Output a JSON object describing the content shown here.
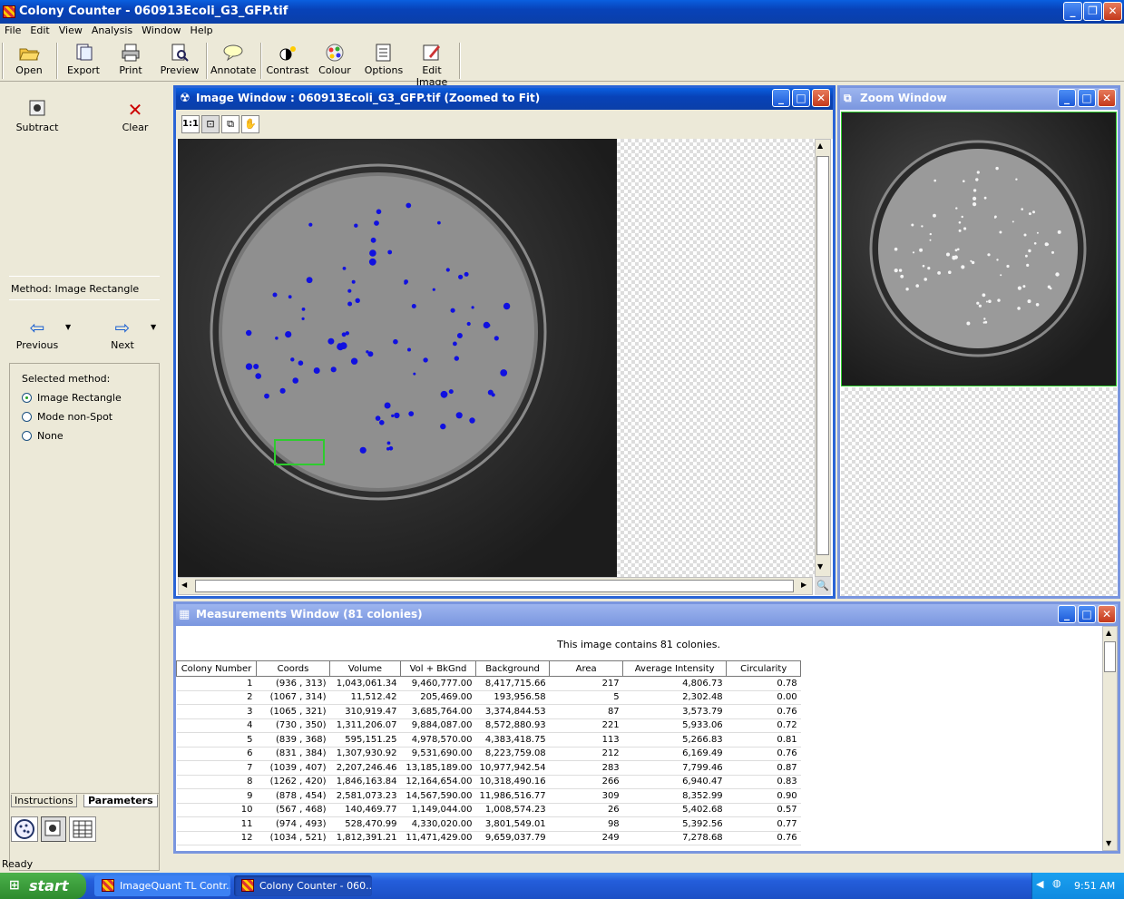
{
  "app": {
    "title": "Colony Counter - 060913Ecoli_G3_GFP.tif"
  },
  "menu": [
    "File",
    "Edit",
    "View",
    "Analysis",
    "Window",
    "Help"
  ],
  "toolbar": [
    {
      "label": "Open",
      "icon": "open-folder-icon"
    },
    {
      "label": "Export",
      "icon": "export-icon"
    },
    {
      "label": "Print",
      "icon": "print-icon"
    },
    {
      "label": "Preview",
      "icon": "preview-icon"
    },
    {
      "label": "Annotate",
      "icon": "annotate-icon"
    },
    {
      "label": "Contrast",
      "icon": "contrast-icon"
    },
    {
      "label": "Colour",
      "icon": "colour-icon"
    },
    {
      "label": "Options",
      "icon": "options-icon"
    },
    {
      "label": "Edit Image",
      "icon": "edit-image-icon"
    }
  ],
  "left": {
    "subtract": "Subtract",
    "clear": "Clear",
    "method": "Method: Image Rectangle",
    "previous": "Previous",
    "next": "Next",
    "selected_method": "Selected method:",
    "options": [
      "Image Rectangle",
      "Mode non-Spot",
      "None"
    ],
    "selected_index": 0,
    "tab_instructions": "Instructions",
    "tab_parameters": "Parameters"
  },
  "image_window": {
    "title": "Image Window : 060913Ecoli_G3_GFP.tif (Zoomed to Fit)",
    "zoom_11": "1:1"
  },
  "zoom_window": {
    "title": "Zoom Window"
  },
  "measurements": {
    "title": "Measurements Window (81 colonies)",
    "summary": "This image contains 81 colonies.",
    "columns": [
      "Colony Number",
      "Coords",
      "Volume",
      "Vol + BkGnd",
      "Background",
      "Area",
      "Average Intensity",
      "Circularity"
    ],
    "rows": [
      [
        "1",
        "(936 , 313)",
        "1,043,061.34",
        "9,460,777.00",
        "8,417,715.66",
        "217",
        "4,806.73",
        "0.78"
      ],
      [
        "2",
        "(1067 , 314)",
        "11,512.42",
        "205,469.00",
        "193,956.58",
        "5",
        "2,302.48",
        "0.00"
      ],
      [
        "3",
        "(1065 , 321)",
        "310,919.47",
        "3,685,764.00",
        "3,374,844.53",
        "87",
        "3,573.79",
        "0.76"
      ],
      [
        "4",
        "(730 , 350)",
        "1,311,206.07",
        "9,884,087.00",
        "8,572,880.93",
        "221",
        "5,933.06",
        "0.72"
      ],
      [
        "5",
        "(839 , 368)",
        "595,151.25",
        "4,978,570.00",
        "4,383,418.75",
        "113",
        "5,266.83",
        "0.81"
      ],
      [
        "6",
        "(831 , 384)",
        "1,307,930.92",
        "9,531,690.00",
        "8,223,759.08",
        "212",
        "6,169.49",
        "0.76"
      ],
      [
        "7",
        "(1039 , 407)",
        "2,207,246.46",
        "13,185,189.00",
        "10,977,942.54",
        "283",
        "7,799.46",
        "0.87"
      ],
      [
        "8",
        "(1262 , 420)",
        "1,846,163.84",
        "12,164,654.00",
        "10,318,490.16",
        "266",
        "6,940.47",
        "0.83"
      ],
      [
        "9",
        "(878 , 454)",
        "2,581,073.23",
        "14,567,590.00",
        "11,986,516.77",
        "309",
        "8,352.99",
        "0.90"
      ],
      [
        "10",
        "(567 , 468)",
        "140,469.77",
        "1,149,044.00",
        "1,008,574.23",
        "26",
        "5,402.68",
        "0.57"
      ],
      [
        "11",
        "(974 , 493)",
        "528,470.99",
        "4,330,020.00",
        "3,801,549.01",
        "98",
        "5,392.56",
        "0.77"
      ],
      [
        "12",
        "(1034 , 521)",
        "1,812,391.21",
        "11,471,429.00",
        "9,659,037.79",
        "249",
        "7,278.68",
        "0.76"
      ]
    ]
  },
  "status": "Ready",
  "taskbar": {
    "start": "start",
    "tasks": [
      "ImageQuant TL Contr...",
      "Colony Counter - 060..."
    ],
    "clock": "9:51 AM"
  }
}
